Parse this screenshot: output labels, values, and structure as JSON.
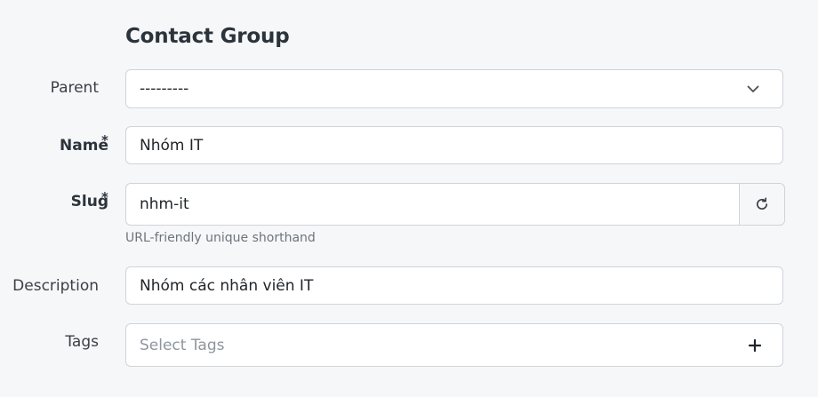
{
  "form": {
    "title": "Contact Group",
    "parent": {
      "label": "Parent",
      "value": "---------",
      "icon": "chevron-down-icon"
    },
    "name": {
      "label": "Name",
      "required_mark": "*",
      "value": "Nhóm IT"
    },
    "slug": {
      "label": "Slug",
      "required_mark": "*",
      "value": "nhm-it",
      "help_text": "URL-friendly unique shorthand",
      "regenerate_icon": "refresh-icon"
    },
    "description": {
      "label": "Description",
      "value": "Nhóm các nhân viên IT"
    },
    "tags": {
      "label": "Tags",
      "placeholder": "Select Tags",
      "add_icon": "plus-icon"
    }
  }
}
